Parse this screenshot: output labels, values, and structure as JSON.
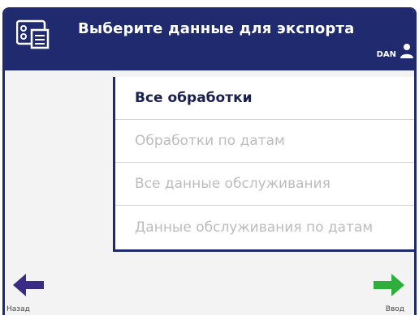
{
  "header": {
    "title": "Выберите данные для экспорта",
    "icon": "export-data-icon",
    "user": "DAN",
    "user_icon": "user-icon",
    "bg_color": "#1f2b6e"
  },
  "menu": {
    "items": [
      {
        "label": "Все обработки",
        "state": "active"
      },
      {
        "label": "Обработки по датам",
        "state": "disabled"
      },
      {
        "label": "Все данные обслуживания",
        "state": "disabled"
      },
      {
        "label": "Данные обслуживания по датам",
        "state": "disabled"
      }
    ]
  },
  "nav": {
    "back_label": "Назад",
    "back_icon": "arrow-left-icon",
    "back_color": "#3a2b86",
    "next_label": "Ввод",
    "next_icon": "arrow-right-icon",
    "next_color": "#2eae3a"
  }
}
